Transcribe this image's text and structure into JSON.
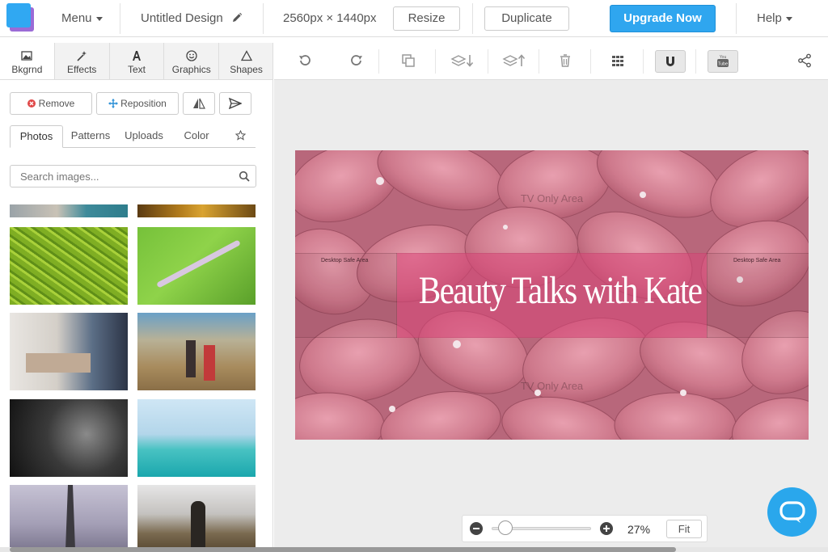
{
  "header": {
    "menu_label": "Menu",
    "design_title": "Untitled Design",
    "dimensions": "2560px × 1440px",
    "resize_label": "Resize",
    "duplicate_label": "Duplicate",
    "upgrade_label": "Upgrade Now",
    "help_label": "Help"
  },
  "left_panel": {
    "tabs": [
      {
        "label": "Bkgrnd",
        "icon": "image-icon",
        "active": true
      },
      {
        "label": "Effects",
        "icon": "magic-wand-icon"
      },
      {
        "label": "Text",
        "icon": "text-a-icon"
      },
      {
        "label": "Graphics",
        "icon": "smiley-icon"
      },
      {
        "label": "Shapes",
        "icon": "triangle-icon"
      }
    ],
    "actions": {
      "remove_label": "Remove",
      "reposition_label": "Reposition"
    },
    "subtabs": [
      {
        "label": "Photos",
        "active": true
      },
      {
        "label": "Patterns"
      },
      {
        "label": "Uploads"
      },
      {
        "label": "Color"
      }
    ],
    "search_placeholder": "Search images..."
  },
  "canvas": {
    "title": "Beauty Talks with Kate",
    "tv_only_label": "TV Only Area",
    "desktop_safe_label": "Desktop Safe Area"
  },
  "zoom": {
    "level_label": "27%",
    "level_fraction": 0.27,
    "fit_label": "Fit"
  },
  "colors": {
    "accent": "#2fa6ef",
    "title_box": "#e14b7d",
    "logo_back": "#9b6bd6",
    "logo_front": "#30a8f2"
  }
}
